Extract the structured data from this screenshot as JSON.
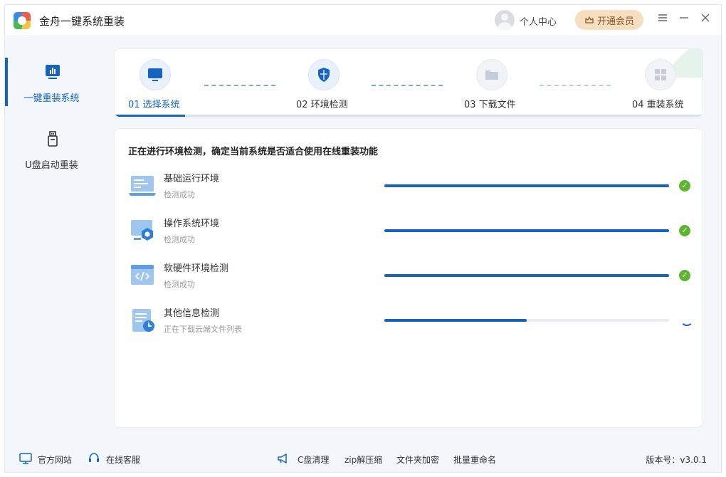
{
  "app": {
    "title": "金舟一键系统重装"
  },
  "header": {
    "user_center": "个人中心",
    "vip_label": "开通会员"
  },
  "sidebar": {
    "items": [
      {
        "label": "一键重装系统",
        "active": true,
        "icon": "chart-monitor-icon"
      },
      {
        "label": "U盘启动重装",
        "active": false,
        "icon": "usb-drive-icon"
      }
    ]
  },
  "steps": [
    {
      "label": "01 选择系统",
      "state": "active",
      "icon": "monitor-icon"
    },
    {
      "label": "02 环境检测",
      "state": "current",
      "icon": "shield-icon"
    },
    {
      "label": "03 下载文件",
      "state": "pending",
      "icon": "folder-icon"
    },
    {
      "label": "04 重装系统",
      "state": "pending",
      "icon": "windows-grid-icon"
    }
  ],
  "detection": {
    "title": "正在进行环境检测，确定当前系统是否适合使用在线重装功能",
    "items": [
      {
        "name": "基础运行环境",
        "status": "检测成功",
        "progress": 1.0,
        "done": true,
        "icon": "laptop-icon"
      },
      {
        "name": "操作系统环境",
        "status": "检测成功",
        "progress": 1.0,
        "done": true,
        "icon": "system-settings-icon"
      },
      {
        "name": "软硬件环境检测",
        "status": "检测成功",
        "progress": 1.0,
        "done": true,
        "icon": "code-window-icon"
      },
      {
        "name": "其他信息检测",
        "status": "正在下载云端文件列表",
        "progress": 0.5,
        "done": false,
        "icon": "document-clock-icon"
      }
    ]
  },
  "footer": {
    "official_site": "官方网站",
    "online_service": "在线客服",
    "c_clean": "C盘清理",
    "zip": "zip解压缩",
    "folder_encrypt": "文件夹加密",
    "batch_rename": "批量重命名",
    "version": "版本号：v3.0.1"
  },
  "colors": {
    "accent": "#1565c0",
    "success": "#5cb630",
    "vip_bg": "#f6dfc0"
  }
}
